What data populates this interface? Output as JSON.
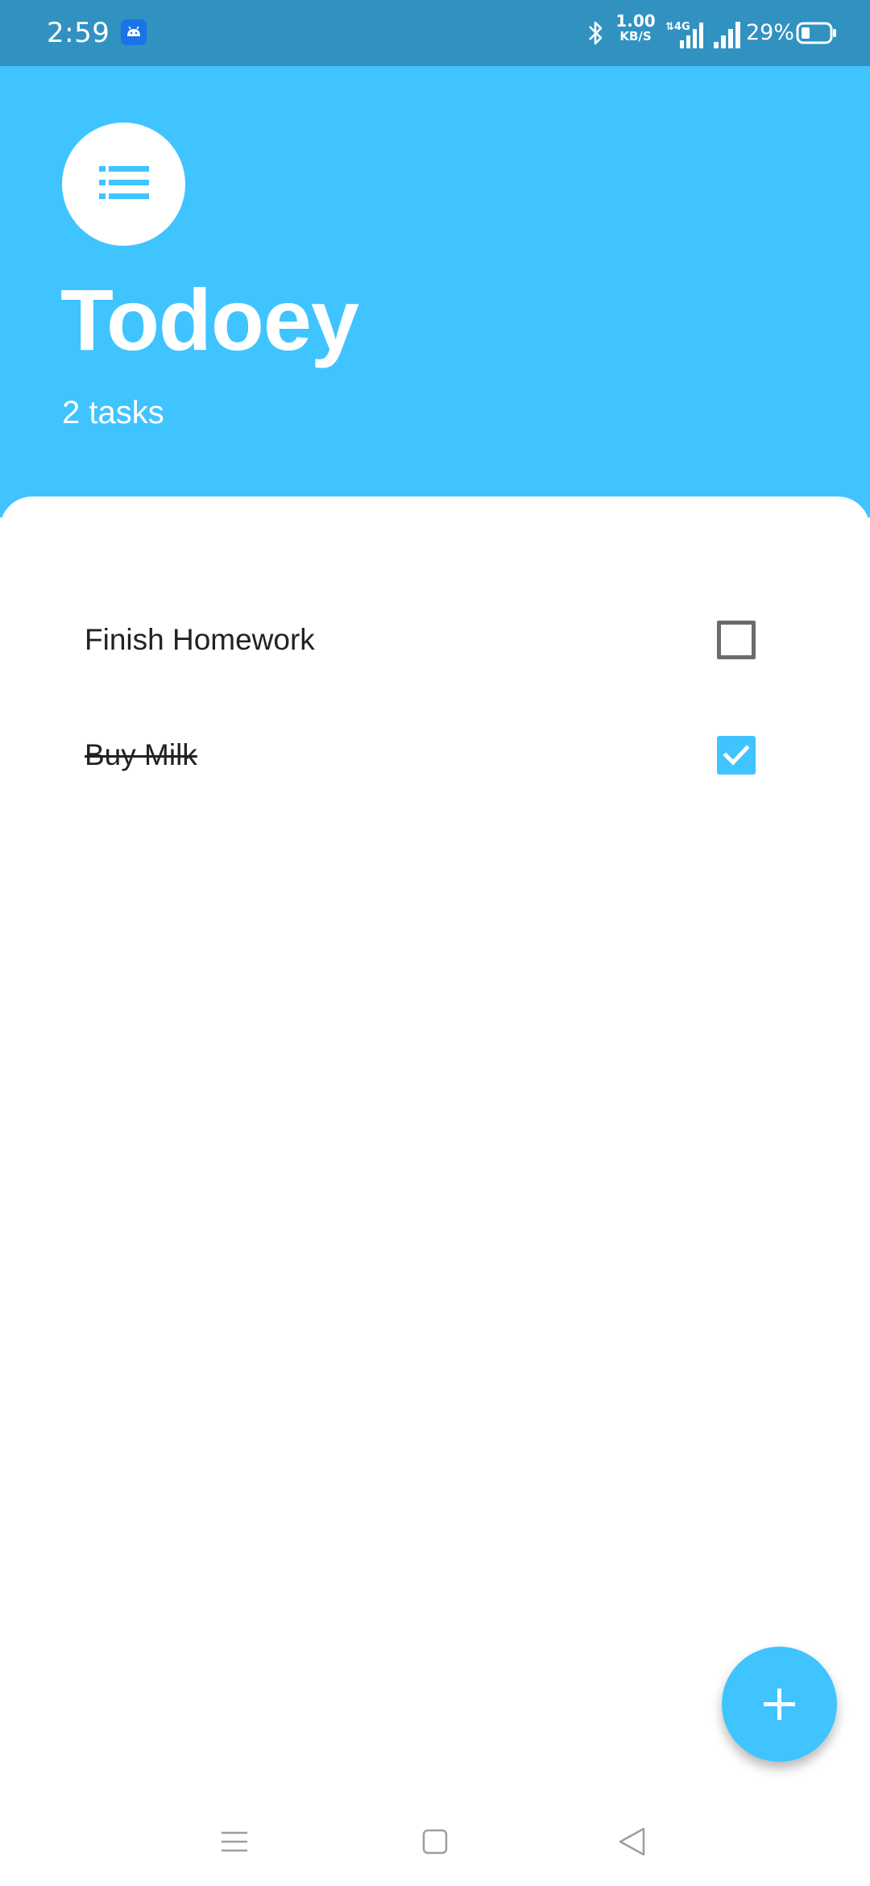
{
  "status_bar": {
    "time": "2:59",
    "net_speed_value": "1.00",
    "net_speed_unit": "KB/S",
    "battery_percent": "29%",
    "icons": [
      "android-app-icon",
      "bluetooth-icon",
      "4g-signal-icon",
      "signal-icon",
      "battery-icon"
    ]
  },
  "header": {
    "title": "Todoey",
    "task_count": "2 tasks",
    "icon": "list-icon"
  },
  "tasks": [
    {
      "title": "Finish Homework",
      "done": false
    },
    {
      "title": "Buy Milk",
      "done": true
    }
  ],
  "fab": {
    "icon": "plus-icon"
  },
  "nav_bar": {
    "icons": [
      "menu-icon",
      "home-icon",
      "back-icon"
    ]
  },
  "colors": {
    "status_bar": "#3192c2",
    "primary": "#40c4ff",
    "text": "#222222",
    "checkbox_border": "#6c6c6c",
    "nav_icon": "#9e9e9e"
  }
}
